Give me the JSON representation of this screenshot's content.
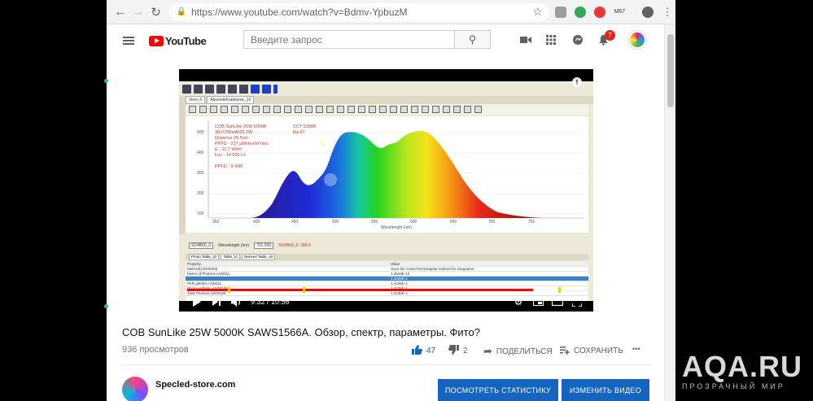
{
  "browser": {
    "url": "https://www.youtube.com/watch?v=Bdmv-YpbuzM",
    "extension_label": "M67"
  },
  "youtube": {
    "logo_text": "YouTube",
    "search_placeholder": "Введите запрос",
    "notification_count": "7"
  },
  "video": {
    "current_time": "9:32",
    "duration": "10:56",
    "time_display": "9:32 / 10:56",
    "progress_fraction": 0.87,
    "loaded_fraction": 0.95,
    "embedded_app": {
      "annotations_left": [
        "COB SunLike 25W 5000K",
        "36V/700mA/25.2W",
        "Distance 25.5cm",
        "PPFD - 237 µMoles/m²/sec",
        "E - 11.7 W/m²",
        "Lux - 14 500 Lx",
        "",
        "PPFD - 9.4/W"
      ],
      "annotations_right": [
        "CCT 5300K",
        "Ra 97"
      ],
      "x_ticks": [
        "350",
        "400",
        "450",
        "500",
        "550",
        "600",
        "650",
        "700",
        "750"
      ],
      "x_axis_label": "Wavelength (nm)",
      "y_ticks": [
        "500",
        "400",
        "300",
        "200",
        "100"
      ],
      "table_header": [
        "Property",
        "Value"
      ],
      "table_rows": [
        [
          "Method(ASD0003)",
          "Uses the closed Rectangular method for integration."
        ],
        [
          "Moles of Photons ASD011",
          "1.4518E-10"
        ],
        [
          "",
          "1.4236E-1"
        ],
        [
          "PAR µMoles ASD011",
          "1.4236E-1"
        ],
        [
          "Photosynthetic ASD0136",
          "1.4236E-1"
        ],
        [
          "Total Photons ASD0136",
          "1.4236E-1"
        ]
      ]
    }
  },
  "meta": {
    "title": "COB SunLike 25W 5000K SAWS1566A. Обзор, спектр, параметры. Фито?",
    "views": "936 просмотров",
    "likes": "47",
    "dislikes": "2",
    "share_label": "ПОДЕЛИТЬСЯ",
    "save_label": "СОХРАНИТЬ",
    "more_label": "•••"
  },
  "channel": {
    "name": "Specled-store.com",
    "stats_button": "ПОСМОТРЕТЬ СТАТИСТИКУ",
    "edit_button": "ИЗМЕНИТЬ ВИДЕО"
  },
  "watermark": {
    "brand": "AQA.RU",
    "tagline": "ПРОЗРАЧНЫЙ МИР"
  }
}
